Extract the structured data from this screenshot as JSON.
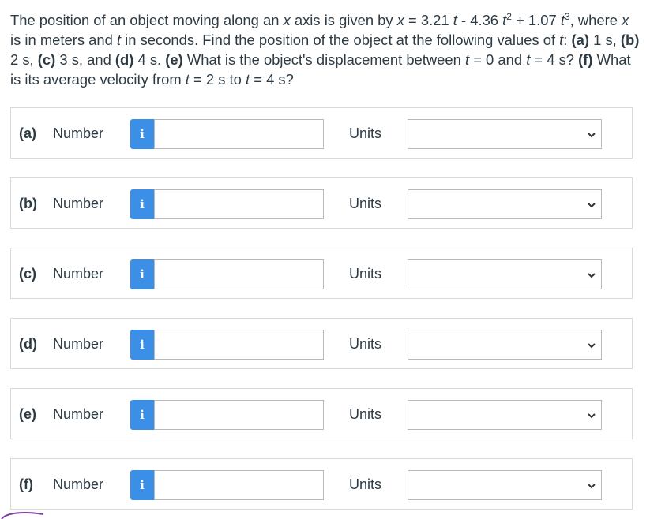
{
  "question": {
    "seg1": "The position of an object moving along an ",
    "x_var": "x",
    "seg2": " axis is given by ",
    "eq_x": "x",
    "seg3": " = 3.21 ",
    "eq_t1": "t",
    "seg4": " - 4.36 ",
    "eq_t2": "t",
    "sup2": "2",
    "seg5": " + 1.07 ",
    "eq_t3": "t",
    "sup3": "3",
    "seg6": ", where ",
    "x_var2": "x",
    "seg7": " is in meters and ",
    "t_var": "t",
    "seg8": " in seconds. Find the position of the object at the following values of ",
    "t_var2": "t",
    "seg9": ": ",
    "pa": "(a)",
    "va": " 1 s, ",
    "pb": "(b)",
    "vb": " 2 s, ",
    "pc": "(c)",
    "vc": " 3 s, and ",
    "pd": "(d)",
    "vd": " 4 s. ",
    "pe": "(e)",
    "ve": " What is the object's displacement between ",
    "t_e1": "t",
    "ve2": " = 0 and ",
    "t_e2": "t",
    "ve3": " = 4 s? ",
    "pf": "(f)",
    "vf": " What is its average velocity from ",
    "t_f1": "t",
    "vf2": " = 2 s to ",
    "t_f2": "t",
    "vf3": " = 4 s?"
  },
  "rows": [
    {
      "part": "(a)",
      "number_label": "Number",
      "info_icon": "i",
      "value": "",
      "units_label": "Units",
      "units_value": ""
    },
    {
      "part": "(b)",
      "number_label": "Number",
      "info_icon": "i",
      "value": "",
      "units_label": "Units",
      "units_value": ""
    },
    {
      "part": "(c)",
      "number_label": "Number",
      "info_icon": "i",
      "value": "",
      "units_label": "Units",
      "units_value": ""
    },
    {
      "part": "(d)",
      "number_label": "Number",
      "info_icon": "i",
      "value": "",
      "units_label": "Units",
      "units_value": ""
    },
    {
      "part": "(e)",
      "number_label": "Number",
      "info_icon": "i",
      "value": "",
      "units_label": "Units",
      "units_value": ""
    },
    {
      "part": "(f)",
      "number_label": "Number",
      "info_icon": "i",
      "value": "",
      "units_label": "Units",
      "units_value": ""
    }
  ],
  "colors": {
    "info_button": "#3b8fe6",
    "text": "#2d3b45",
    "border": "#d9d9d9",
    "scribble": "#7b3fa0"
  },
  "icons": {
    "info": "info-icon",
    "chevron": "chevron-down-icon"
  }
}
